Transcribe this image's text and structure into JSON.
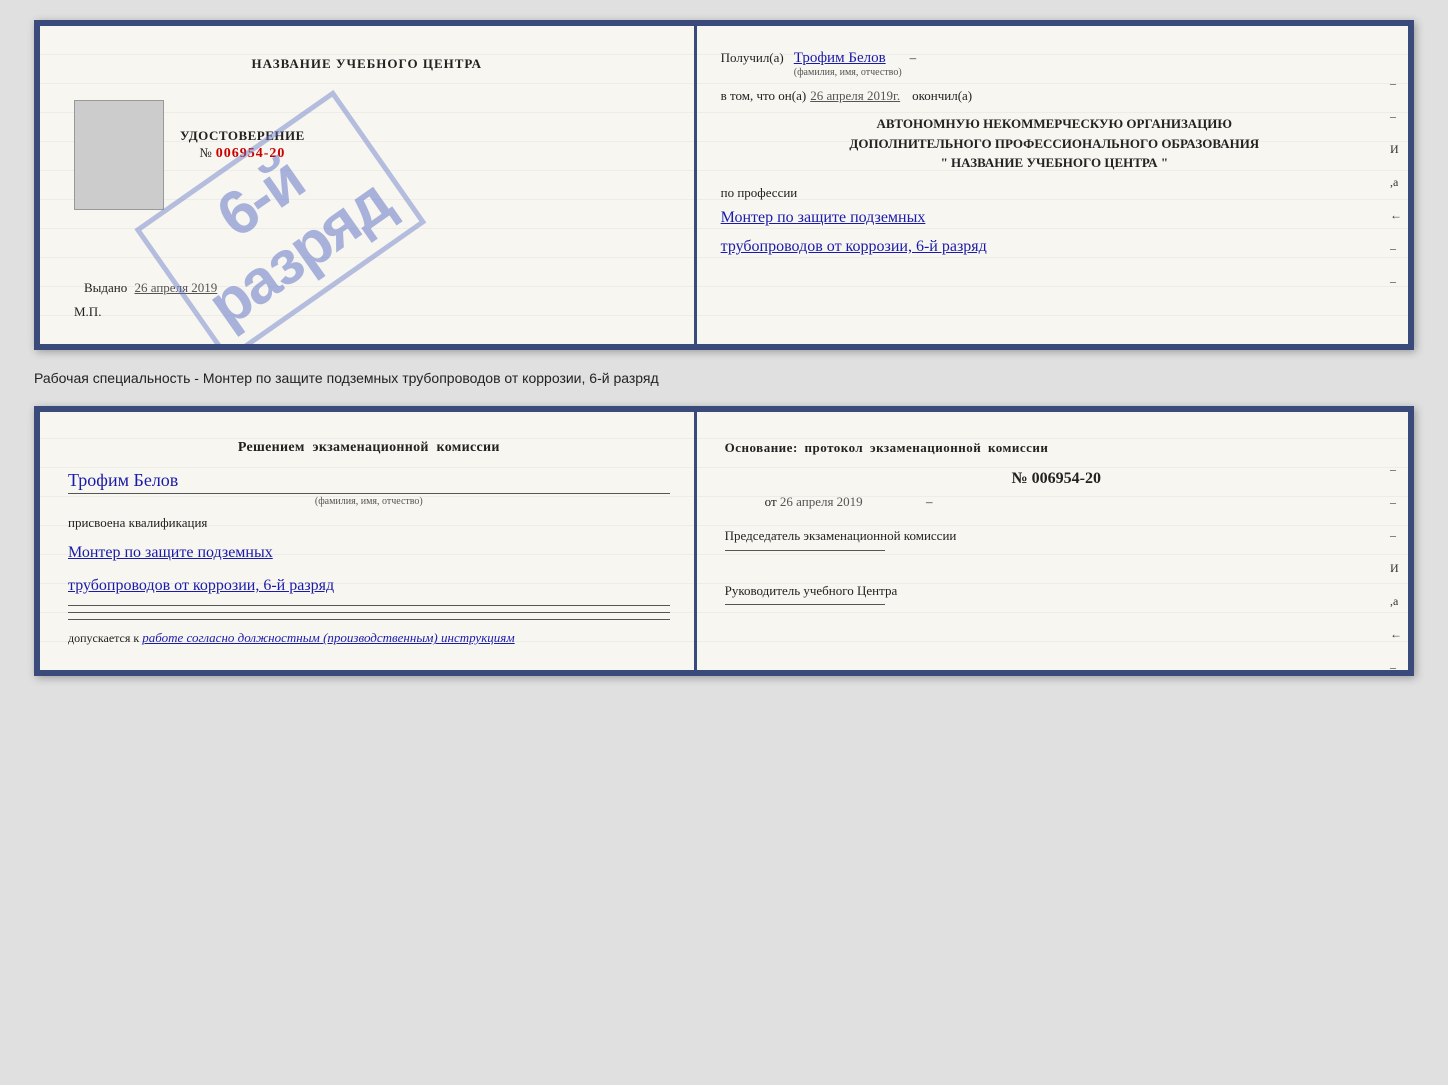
{
  "cert": {
    "left": {
      "title": "НАЗВАНИЕ УЧЕБНОГО ЦЕНТРА",
      "stamp_line1": "6-й",
      "stamp_line2": "разряд",
      "udostoverenie_label": "УДОСТОВЕРЕНИЕ",
      "number_prefix": "№",
      "number": "006954-20",
      "vydano_label": "Выдано",
      "vydano_date": "26 апреля 2019",
      "mp": "М.П."
    },
    "right": {
      "poluchil_label": "Получил(a)",
      "recipient_name": "Трофим Белов",
      "recipient_subtitle": "(фамилия, имя, отчество)",
      "dash1": "–",
      "vtom_label": "в том, что он(а)",
      "date_value": "26 апреля 2019г.",
      "okonchil_label": "окончил(a)",
      "org_line1": "АВТОНОМНУЮ НЕКОММЕРЧЕСКУЮ ОРГАНИЗАЦИЮ",
      "org_line2": "ДОПОЛНИТЕЛЬНОГО ПРОФЕССИОНАЛЬНОГО ОБРАЗОВАНИЯ",
      "org_line3": "\"  НАЗВАНИЕ УЧЕБНОГО ЦЕНТРА  \"",
      "po_professii": "по профессии",
      "profession_line1": "Монтер по защите подземных",
      "profession_line2": "трубопроводов от коррозии, 6-й разряд",
      "side_marks": [
        "–",
        "–",
        "И",
        ",а",
        "←",
        "–",
        "–",
        "–",
        "–"
      ]
    }
  },
  "middle_text": "Рабочая специальность - Монтер по защите подземных трубопроводов от коррозии, 6-й разряд",
  "exam": {
    "left": {
      "title": "Решением  экзаменационной  комиссии",
      "name": "Трофим Белов",
      "name_subtitle": "(фамилия, имя, отчество)",
      "prisvoena_label": "присвоена квалификация",
      "profession_line1": "Монтер по защите подземных",
      "profession_line2": "трубопроводов от коррозии, 6-й разряд",
      "dopusk_label": "допускается к",
      "dopusk_value": "работе согласно должностным (производственным) инструкциям"
    },
    "right": {
      "title": "Основание:  протокол  экзаменационной  комиссии",
      "number_prefix": "№",
      "number": "006954-20",
      "date_prefix": "от",
      "date_value": "26 апреля 2019",
      "chairman_label": "Председатель экзаменационной комиссии",
      "rukovoditel_label": "Руководитель учебного Центра",
      "side_marks": [
        "–",
        "–",
        "–",
        "И",
        ",а",
        "←",
        "–",
        "–",
        "–",
        "–"
      ]
    }
  }
}
